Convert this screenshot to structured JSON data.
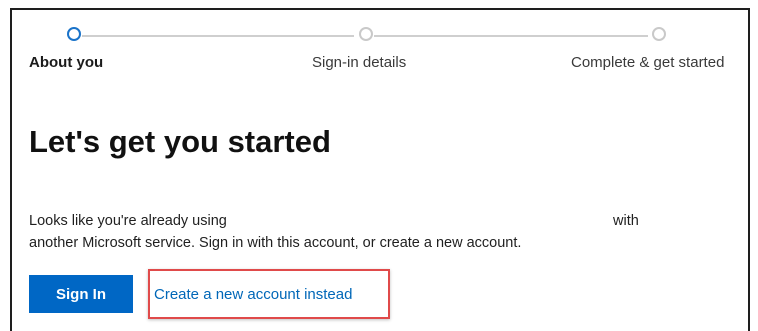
{
  "stepper": {
    "steps": [
      {
        "label": "About you",
        "state": "active"
      },
      {
        "label": "Sign-in details",
        "state": "inactive"
      },
      {
        "label": "Complete & get started",
        "state": "inactive"
      }
    ]
  },
  "main": {
    "heading": "Let's get you started",
    "description_line1_start": "Looks like you're already using",
    "description_line1_end": "with",
    "description_line2": "another Microsoft service. Sign in with this account, or create a new account.",
    "sign_in_label": "Sign In",
    "create_link_label": "Create a new account instead"
  },
  "colors": {
    "primary_button": "#0067c5",
    "link": "#0067b8",
    "active_step": "#1a73c9",
    "highlight": "#e04a4a"
  }
}
